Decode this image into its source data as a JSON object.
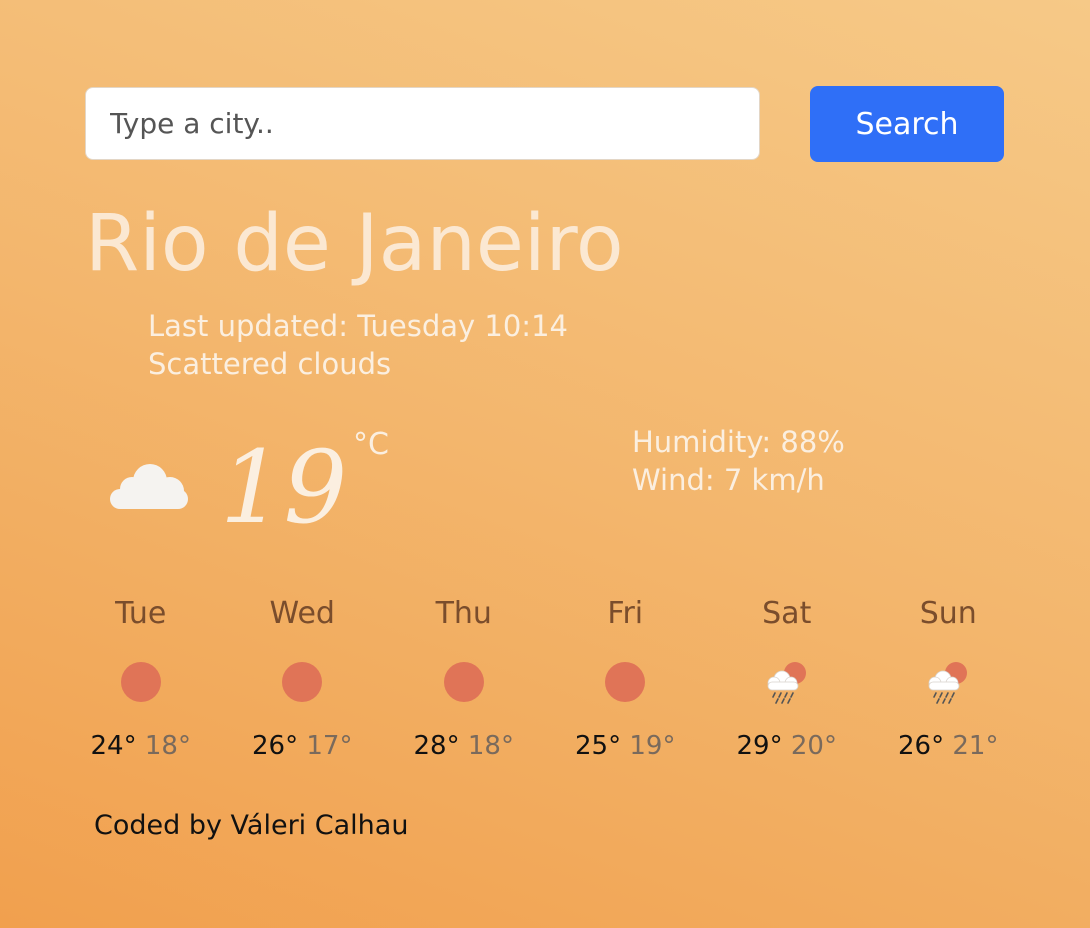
{
  "search": {
    "placeholder": "Type a city..",
    "button_label": "Search"
  },
  "current": {
    "city": "Rio de Janeiro",
    "last_updated": "Last updated: Tuesday 10:14",
    "description": "Scattered clouds",
    "icon": "cloud-icon",
    "temperature": "19",
    "unit": "°C",
    "humidity": "Humidity: 88%",
    "wind": "Wind: 7 km/h"
  },
  "forecast": [
    {
      "day": "Tue",
      "icon": "sun-icon",
      "max": "24°",
      "min": "18°"
    },
    {
      "day": "Wed",
      "icon": "sun-icon",
      "max": "26°",
      "min": "17°"
    },
    {
      "day": "Thu",
      "icon": "sun-icon",
      "max": "28°",
      "min": "18°"
    },
    {
      "day": "Fri",
      "icon": "sun-icon",
      "max": "25°",
      "min": "19°"
    },
    {
      "day": "Sat",
      "icon": "rain-sun-icon",
      "max": "29°",
      "min": "20°"
    },
    {
      "day": "Sun",
      "icon": "rain-sun-icon",
      "max": "26°",
      "min": "21°"
    }
  ],
  "footer": {
    "credit": "Coded by Váleri Calhau"
  },
  "colors": {
    "accent": "#2f6ff7",
    "sun": "#e07457",
    "background_start": "#f1a04e",
    "background_end": "#f6c987"
  }
}
